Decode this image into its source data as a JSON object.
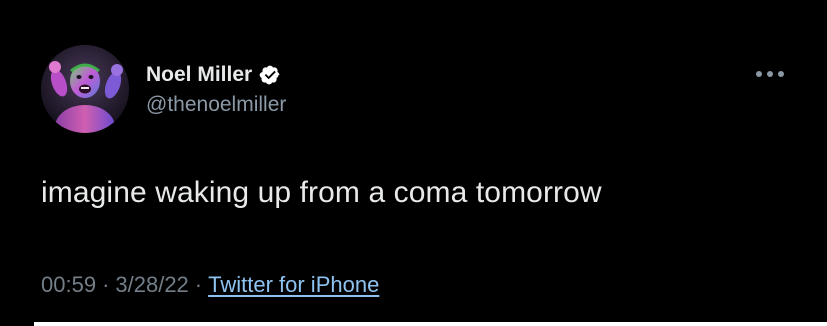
{
  "tweet": {
    "author": {
      "display_name": "Noel Miller",
      "handle": "@thenoelmiller",
      "avatar_icon": "avatar-photo",
      "verified_icon": "verified-badge-icon"
    },
    "text": "imagine waking up from a coma tomorrow",
    "time": "00:59",
    "date": "3/28/22",
    "separator": "·",
    "source": "Twitter for iPhone",
    "more_icon": "more-options-icon"
  },
  "colors": {
    "background": "#000000",
    "text_primary": "#e7e9ea",
    "text_secondary": "#8b98a5",
    "meta_text": "#737e88",
    "link": "#8ec3f1",
    "verified_badge": "#ffffff"
  }
}
